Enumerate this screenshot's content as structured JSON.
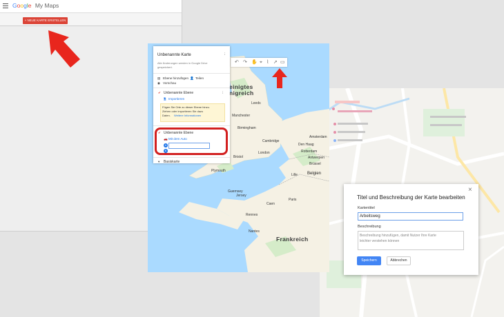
{
  "home": {
    "brand": {
      "g1": "G",
      "g2": "o",
      "g3": "o",
      "g4": "g",
      "g5": "l",
      "g6": "e",
      "product": "My Maps"
    },
    "new_map_button": "+ NEUE KARTE ERSTELLEN"
  },
  "editor": {
    "map_title": "Unbenannte Karte",
    "save_note_line1": "Alle Änderungen werden in Google Drive",
    "save_note_line2": "gespeichert.",
    "add_layer": "Ebene hinzufügen",
    "share": "Teilen",
    "preview": "Vorschau",
    "layer1_title": "Unbenannte Ebene",
    "import": "Importieren",
    "info_line1": "Fügen Sie Orte zu dieser Ebene hinzu.",
    "info_line2": "Ziehen oder importieren Sie dazu",
    "info_line3": "Daten.",
    "info_link": "Weitere Informationen",
    "layer2_title": "Unbenannte Ebene",
    "mode": "Mit dem Auto",
    "point_a": "A",
    "point_b": "B",
    "basemap": "Basiskarte",
    "map_labels": {
      "uk1": "einigtes",
      "uk2": "nigreich",
      "belgien": "Belgien",
      "frankreich": "Frankreich",
      "london": "London",
      "paris": "Paris",
      "birmingham": "Birmingham",
      "manchester": "Manchester",
      "cambridge": "Cambridge",
      "bristol": "Bristol",
      "brussel": "Brüssel",
      "guernsey": "Guernsey",
      "jersey": "Jersey",
      "amsterdam": "Amsterdam",
      "denhaag": "Den Haag",
      "rotterdam": "Rotterdam",
      "antwerpen": "Antwerpen",
      "lille": "Lille",
      "rennes": "Rennes",
      "nantes": "Nantes",
      "caen": "Caen",
      "leeds": "Leeds",
      "plymouth": "Plymouth"
    }
  },
  "dialog": {
    "title": "Titel und Beschreibung der Karte bearbeiten",
    "close": "×",
    "title_label": "Kartentitel",
    "title_value": "Arbeitsweg",
    "desc_label": "Beschreibung",
    "desc_placeholder_line1": "Beschreibung hinzufügen, damit Nutzer Ihre Karte",
    "desc_placeholder_line2": "leichter verstehen können",
    "save": "Speichern",
    "cancel": "Abbrechen"
  },
  "colors": {
    "accent_red": "#db4437",
    "highlight": "#d21f1f",
    "primary_blue": "#4285f4",
    "water": "#aadaff",
    "land": "#f5f1e4"
  }
}
